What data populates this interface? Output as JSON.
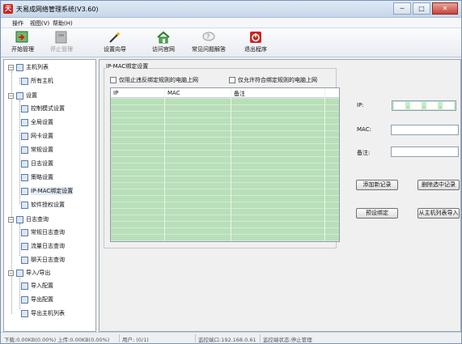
{
  "window": {
    "title": "天易成网络管理系统(V3.60)",
    "controls": [
      "─",
      "□",
      "✕"
    ]
  },
  "menu": [
    "操作",
    "视图(V)",
    "帮助(H)"
  ],
  "toolbar": [
    {
      "label": "开始管理",
      "icon": "start-manage-icon",
      "enabled": true
    },
    {
      "label": "停止管理",
      "icon": "stop-manage-icon",
      "enabled": false
    },
    {
      "label": "设置向导",
      "icon": "wizard-wand-icon",
      "enabled": true
    },
    {
      "label": "访问官网",
      "icon": "home-icon",
      "enabled": true
    },
    {
      "label": "常见问题解答",
      "icon": "faq-icon",
      "enabled": true
    },
    {
      "label": "退出程序",
      "icon": "power-exit-icon",
      "enabled": true
    }
  ],
  "sidebar": {
    "sections": [
      {
        "label": "主机列表",
        "items": [
          "所有主机"
        ]
      },
      {
        "label": "设置",
        "items": [
          "控制模式设置",
          "全局设置",
          "网卡设置",
          "常规设置",
          "日志设置",
          "策略设置",
          "IP-MAC绑定设置",
          "软件授权设置"
        ],
        "selected": "IP-MAC绑定设置"
      },
      {
        "label": "日志查询",
        "items": [
          "常规日志查询",
          "流量日志查询",
          "聊天日志查询"
        ]
      },
      {
        "label": "导入/导出",
        "items": [
          "导入配置",
          "导出配置",
          "导出主机列表"
        ]
      }
    ]
  },
  "main": {
    "group_title": "IP-MAC绑定设置",
    "checkbox_block_violators": "仅阻止违反绑定规则的电脑上网",
    "checkbox_allow_compliant": "仅允许符合绑定规则的电脑上网",
    "table": {
      "columns": [
        "IP",
        "MAC",
        "备注"
      ],
      "rows": []
    },
    "form": {
      "ip_label": "IP:",
      "ip_separators": [
        ".",
        ".",
        "."
      ],
      "mac_label": "MAC:",
      "note_label": "备注:",
      "mac_value": "",
      "note_value": ""
    },
    "buttons": {
      "add": "添加新记录",
      "delete": "删除选中记录",
      "preset": "预设绑定",
      "import": "从主机列表导入"
    }
  },
  "status": {
    "download": "下载:0.00KB(0.00%) 上传:0.00KB(0.00%)",
    "users": "用户: (0/1)",
    "monitor_port": "监控端口:192.168.0.61",
    "monitor_state": "监控端状态:停止管理"
  },
  "colors": {
    "grid_green": "#b9dfb9",
    "ip_box_green": "#c7ebc7",
    "exit_red": "#d2231d"
  }
}
